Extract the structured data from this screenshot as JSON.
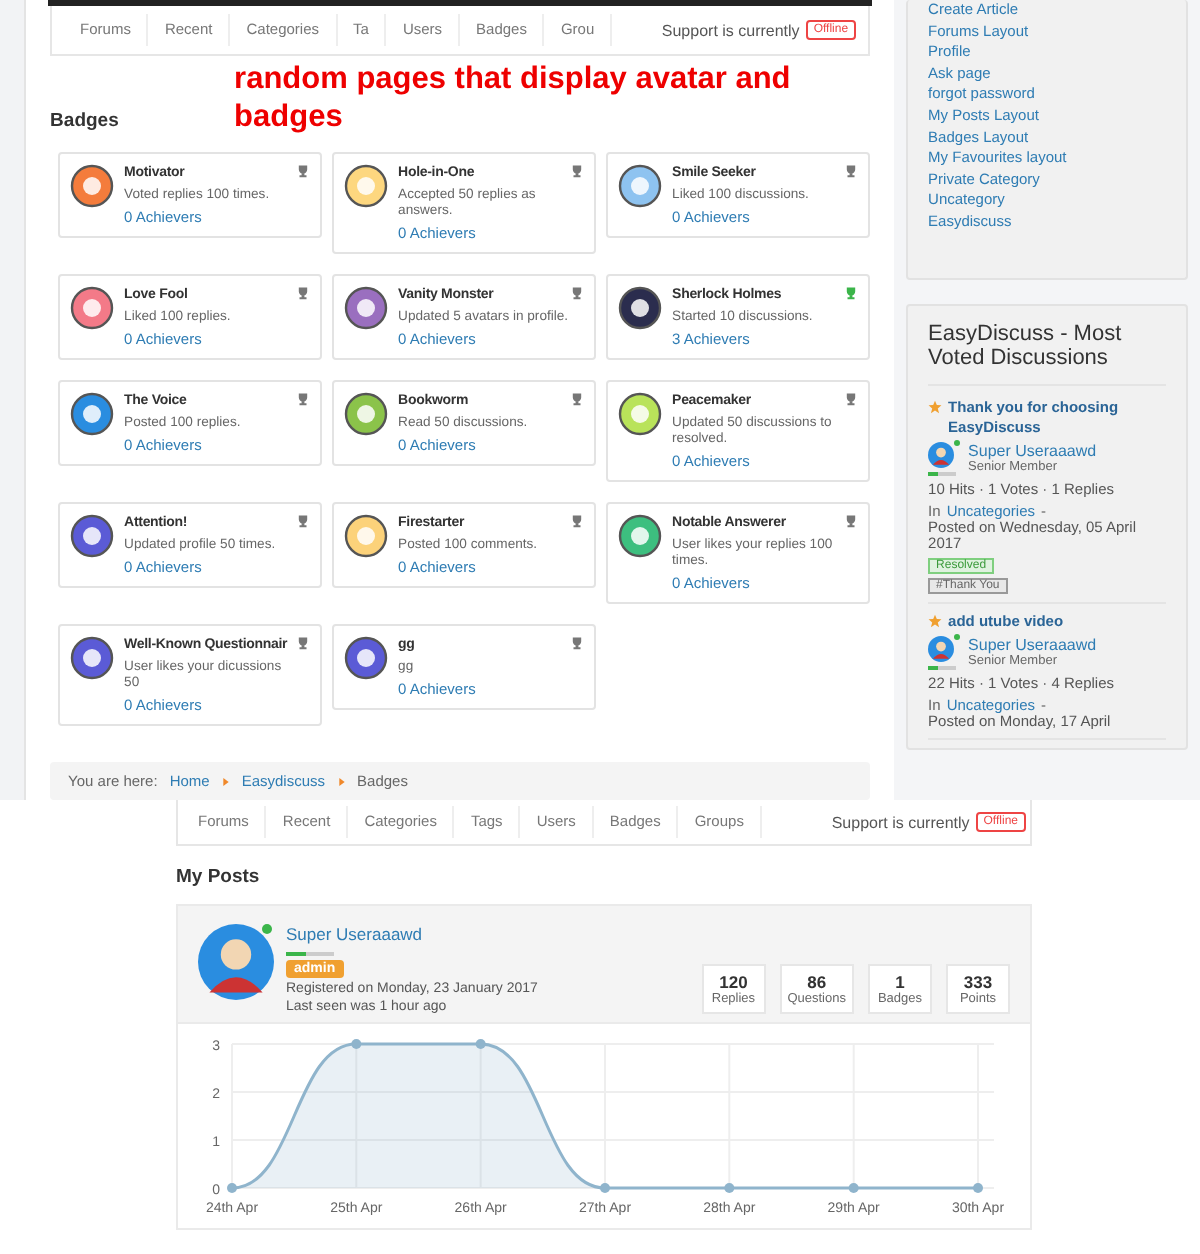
{
  "top": {
    "nav": {
      "tabs": [
        {
          "label": "Forums"
        },
        {
          "label": "Recent"
        },
        {
          "label": "Categories"
        },
        {
          "label": "Ta"
        },
        {
          "label": "Users"
        },
        {
          "label": "Badges"
        },
        {
          "label": "Grou"
        }
      ],
      "support_text": "Support is currently",
      "support_status": "Offline"
    },
    "annotation": "random pages that display avatar and badges",
    "heading": "Badges",
    "badges": [
      {
        "title": "Motivator",
        "description": "Voted replies 100 times.",
        "achievers": "0 Achievers",
        "color": "#f47c3c",
        "achieved": false
      },
      {
        "title": "Hole-in-One",
        "description": "Accepted 50 replies as answers.",
        "achievers": "0 Achievers",
        "color": "#fdd77f",
        "achieved": false
      },
      {
        "title": "Smile Seeker",
        "description": "Liked 100 discussions.",
        "achievers": "0 Achievers",
        "color": "#8ec3f0",
        "achieved": false
      },
      {
        "title": "Love Fool",
        "description": "Liked 100 replies.",
        "achievers": "0 Achievers",
        "color": "#f37a88",
        "achieved": false
      },
      {
        "title": "Vanity Monster",
        "description": "Updated 5 avatars in profile.",
        "achievers": "0 Achievers",
        "color": "#9a6fbf",
        "achieved": false
      },
      {
        "title": "Sherlock Holmes",
        "description": "Started 10 discussions.",
        "achievers": "3 Achievers",
        "color": "#2b2d4e",
        "achieved": true
      },
      {
        "title": "The Voice",
        "description": "Posted 100 replies.",
        "achievers": "0 Achievers",
        "color": "#2a8de0",
        "achieved": false
      },
      {
        "title": "Bookworm",
        "description": "Read 50 discussions.",
        "achievers": "0 Achievers",
        "color": "#8bc34a",
        "achieved": false
      },
      {
        "title": "Peacemaker",
        "description": "Updated 50 discussions to resolved.",
        "achievers": "0 Achievers",
        "color": "#b9e35a",
        "achieved": false
      },
      {
        "title": "Attention!",
        "description": "Updated profile 50 times.",
        "achievers": "0 Achievers",
        "color": "#5b5bd6",
        "achieved": false
      },
      {
        "title": "Firestarter",
        "description": "Posted 100 comments.",
        "achievers": "0 Achievers",
        "color": "#fcd27a",
        "achieved": false
      },
      {
        "title": "Notable Answerer",
        "description": "User likes your replies 100 times.",
        "achievers": "0 Achievers",
        "color": "#3dbf7f",
        "achieved": false
      },
      {
        "title": "Well-Known Questionnair",
        "description": "User likes your dicussions 50",
        "achievers": "0 Achievers",
        "color": "#5b5bd6",
        "achieved": false
      },
      {
        "title": "gg",
        "description": "gg",
        "achievers": "0 Achievers",
        "color": "#5b5bd6",
        "achieved": false
      }
    ],
    "breadcrumb": {
      "prefix": "You are here:",
      "items": [
        "Home",
        "Easydiscuss",
        "Badges"
      ]
    },
    "sidebar": {
      "links": [
        "Create Article",
        "Forums Layout",
        "Profile",
        "Ask page",
        "forgot password",
        "My Posts Layout",
        "Badges Layout",
        "My Favourites layout",
        "Private Category",
        "Uncategory",
        "Easydiscuss"
      ],
      "panel_title": "EasyDiscuss - Most Voted Discussions",
      "discussions": [
        {
          "title": "Thank you for choosing EasyDiscuss",
          "author": "Super Useraaawd",
          "online": true,
          "level": 0.35,
          "rank": "Senior Member",
          "stats": "10 Hits · 1 Votes · 1 Replies",
          "category_prefix": "In",
          "category": "Uncategories",
          "category_suffix": "-",
          "posted": "Posted on Wednesday, 05 April 2017",
          "status": "Resolved",
          "tag": "#Thank You"
        },
        {
          "title": "add utube video",
          "author": "Super Useraaawd",
          "online": true,
          "level": 0.35,
          "rank": "Senior Member",
          "stats": "22 Hits · 1 Votes · 4 Replies",
          "category_prefix": "In",
          "category": "Uncategories",
          "category_suffix": "-",
          "posted": "Posted on Monday, 17 April"
        }
      ]
    }
  },
  "bottom": {
    "nav": {
      "tabs": [
        {
          "label": "Forums"
        },
        {
          "label": "Recent"
        },
        {
          "label": "Categories"
        },
        {
          "label": "Tags"
        },
        {
          "label": "Users"
        },
        {
          "label": "Badges"
        },
        {
          "label": "Groups"
        }
      ],
      "support_text": "Support is currently",
      "support_status": "Offline"
    },
    "heading": "My Posts",
    "profile": {
      "name": "Super Useraaawd",
      "online": true,
      "level": 0.4,
      "role": "admin",
      "registered": "Registered on Monday, 23 January 2017",
      "last_seen": "Last seen was 1 hour ago",
      "stats": [
        {
          "value": "120",
          "label": "Replies"
        },
        {
          "value": "86",
          "label": "Questions"
        },
        {
          "value": "1",
          "label": "Badges"
        },
        {
          "value": "333",
          "label": "Points"
        }
      ]
    },
    "chart_data": {
      "type": "area",
      "categories": [
        "24th Apr",
        "25th Apr",
        "26th Apr",
        "27th Apr",
        "28th Apr",
        "29th Apr",
        "30th Apr"
      ],
      "series": [
        {
          "color": "#8fb4cc",
          "values": [
            0,
            3,
            3,
            0,
            0,
            0,
            0
          ]
        }
      ],
      "grid": true,
      "ylim": [
        0,
        3
      ],
      "yticks": [
        0,
        1,
        2,
        3
      ]
    }
  }
}
